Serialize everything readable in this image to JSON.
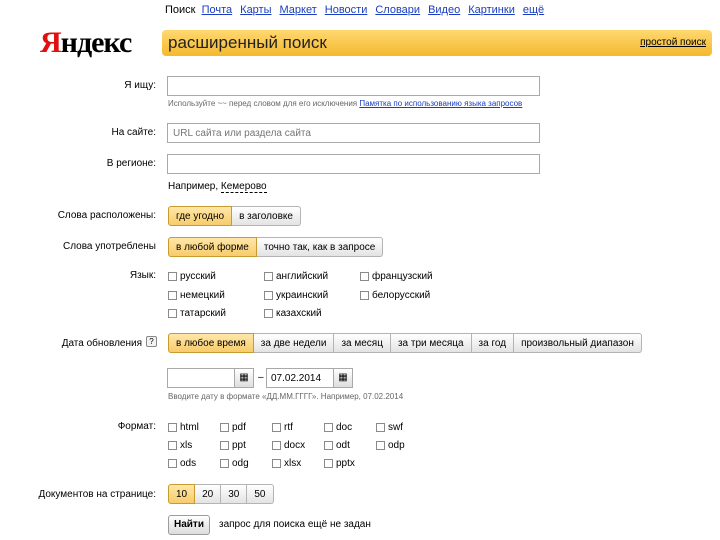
{
  "nav": {
    "items": [
      "Поиск",
      "Почта",
      "Карты",
      "Маркет",
      "Новости",
      "Словари",
      "Видео",
      "Картинки",
      "ещё"
    ],
    "current": "Поиск"
  },
  "logo": {
    "first": "Я",
    "rest": "ндекс"
  },
  "banner": {
    "title": "расширенный поиск",
    "simple_link": "простой поиск"
  },
  "query": {
    "label": "Я ищу:",
    "value": "",
    "hint_prefix": "Используйте ~~ перед словом для его исключения",
    "hint_link": "Памятка по использованию языка запросов"
  },
  "site": {
    "label": "На сайте:",
    "placeholder": "URL сайта или раздела сайта"
  },
  "region": {
    "label": "В регионе:",
    "value": "",
    "example_prefix": "Например, ",
    "example_value": "Кемерово"
  },
  "placement": {
    "label": "Слова расположены:",
    "options": [
      "где угодно",
      "в заголовке"
    ],
    "selected": 0
  },
  "usage": {
    "label": "Слова употреблены",
    "options": [
      "в любой форме",
      "точно так, как в запросе"
    ],
    "selected": 0
  },
  "language": {
    "label": "Язык:",
    "options": [
      "русский",
      "английский",
      "французский",
      "немецкий",
      "украинский",
      "белорусский",
      "татарский",
      "казахский"
    ]
  },
  "date": {
    "label": "Дата обновления",
    "help": "?",
    "options": [
      "в любое время",
      "за две недели",
      "за месяц",
      "за три месяца",
      "за год",
      "произвольный диапазон"
    ],
    "selected": 0,
    "from": "",
    "to": "07.02.2014",
    "dash": "–",
    "hint": "Вводите дату в формате «ДД.ММ.ГГГГ». Например, 07.02.2014"
  },
  "format": {
    "label": "Формат:",
    "options": [
      "html",
      "pdf",
      "rtf",
      "doc",
      "swf",
      "xls",
      "ppt",
      "docx",
      "odt",
      "odp",
      "ods",
      "odg",
      "xlsx",
      "pptx"
    ]
  },
  "per_page": {
    "label": "Документов на странице:",
    "options": [
      "10",
      "20",
      "30",
      "50"
    ],
    "selected": 0
  },
  "submit": {
    "label": "Найти",
    "status": "запрос для поиска ещё не задан"
  },
  "colors": {
    "accent": "#f4b92e",
    "link": "#1a3dc1",
    "logo_red": "#e01010"
  }
}
